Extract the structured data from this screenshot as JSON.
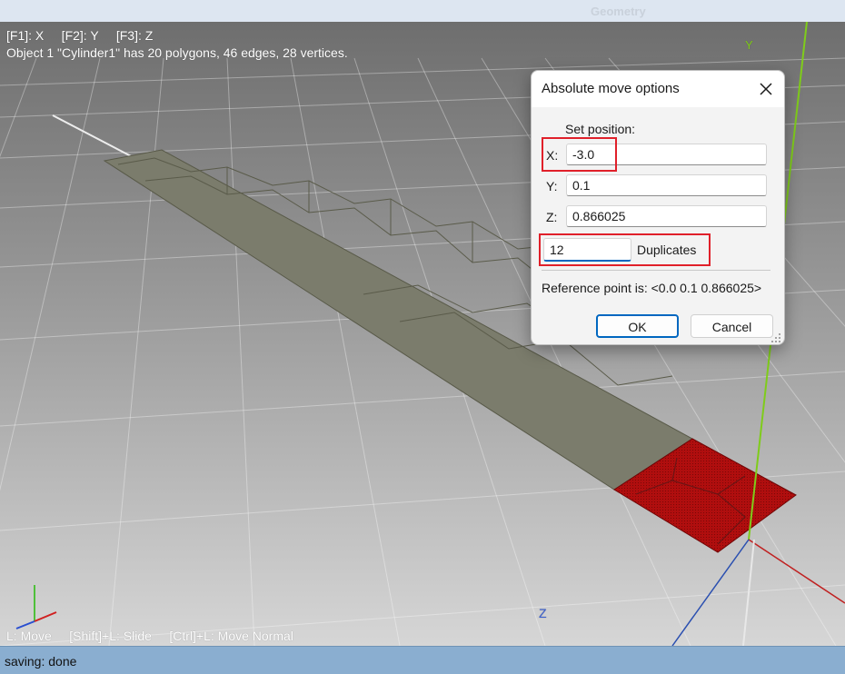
{
  "window": {
    "title": "Geometry"
  },
  "hud": {
    "axis_keys": "[F1]: X     [F2]: Y     [F3]: Z",
    "object_info": "Object 1 \"Cylinder1\" has 20 polygons, 46 edges, 28 vertices.",
    "mode_hint": "L: Move     [Shift]+L: Slide     [Ctrl]+L: Move Normal",
    "axis_y_label": "Y",
    "axis_z_label": "Z"
  },
  "status": {
    "text": "saving: done"
  },
  "dialog": {
    "title": "Absolute move options",
    "set_position_label": "Set position:",
    "x_label": "X:",
    "x_value": "-3.0",
    "y_label": "Y:",
    "y_value": "0.1",
    "z_label": "Z:",
    "z_value": "0.866025",
    "duplicates_value": "12",
    "duplicates_label": "Duplicates",
    "reference_text": "Reference point is: <0.0  0.1  0.866025>",
    "ok_label": "OK",
    "cancel_label": "Cancel"
  },
  "colors": {
    "highlight_box": "#e0202a",
    "strip": "#7b7c6c",
    "selected_faces": "#b00e0e",
    "axis_y": "#7fcc1a",
    "axis_x": "#c02020",
    "axis_z": "#2a4fb0",
    "status_bar": "#8aaed0"
  }
}
